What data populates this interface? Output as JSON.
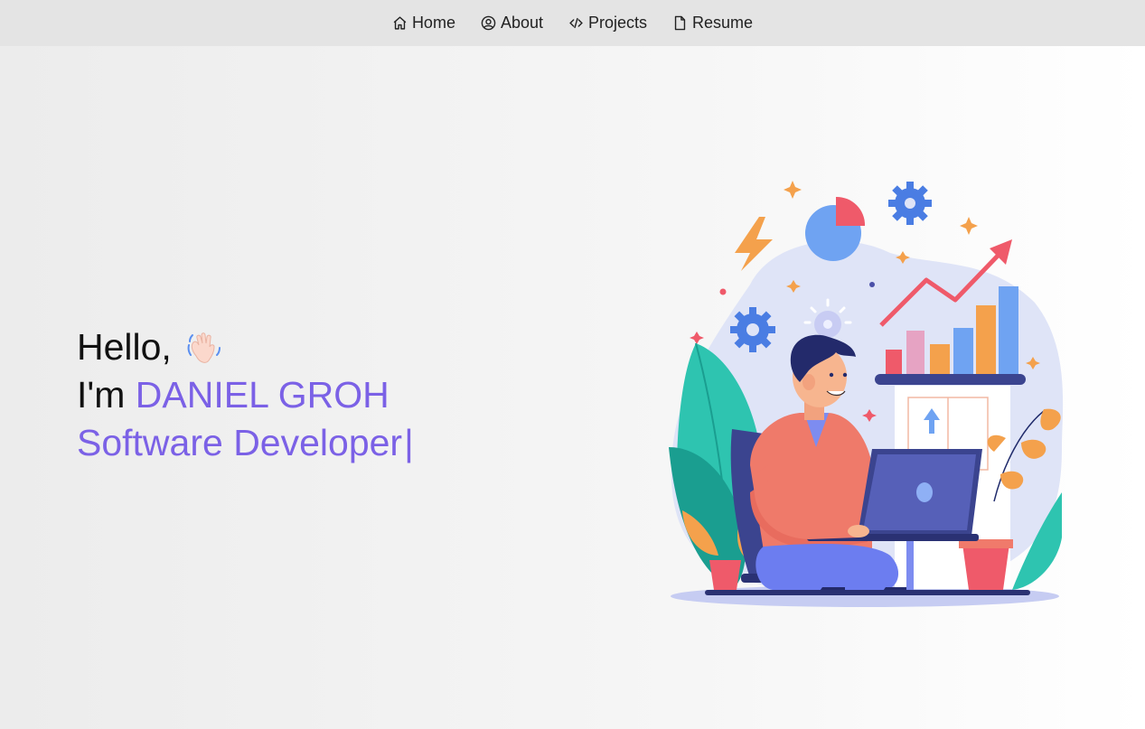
{
  "theme": {
    "accent": "#7b61e6",
    "nav_bg": "#e4e4e4"
  },
  "nav": {
    "items": [
      {
        "label": "Home",
        "icon": "home-icon"
      },
      {
        "label": "About",
        "icon": "user-circle-icon"
      },
      {
        "label": "Projects",
        "icon": "code-icon"
      },
      {
        "label": "Resume",
        "icon": "document-icon"
      }
    ]
  },
  "hero": {
    "greeting": "Hello,",
    "wave_icon": "waving-hand-icon",
    "intro": "I'm ",
    "name": "DANIEL GROH",
    "role": "Software Developer",
    "cursor": "|"
  },
  "illustration": {
    "icon": "developer-at-laptop-illustration"
  }
}
